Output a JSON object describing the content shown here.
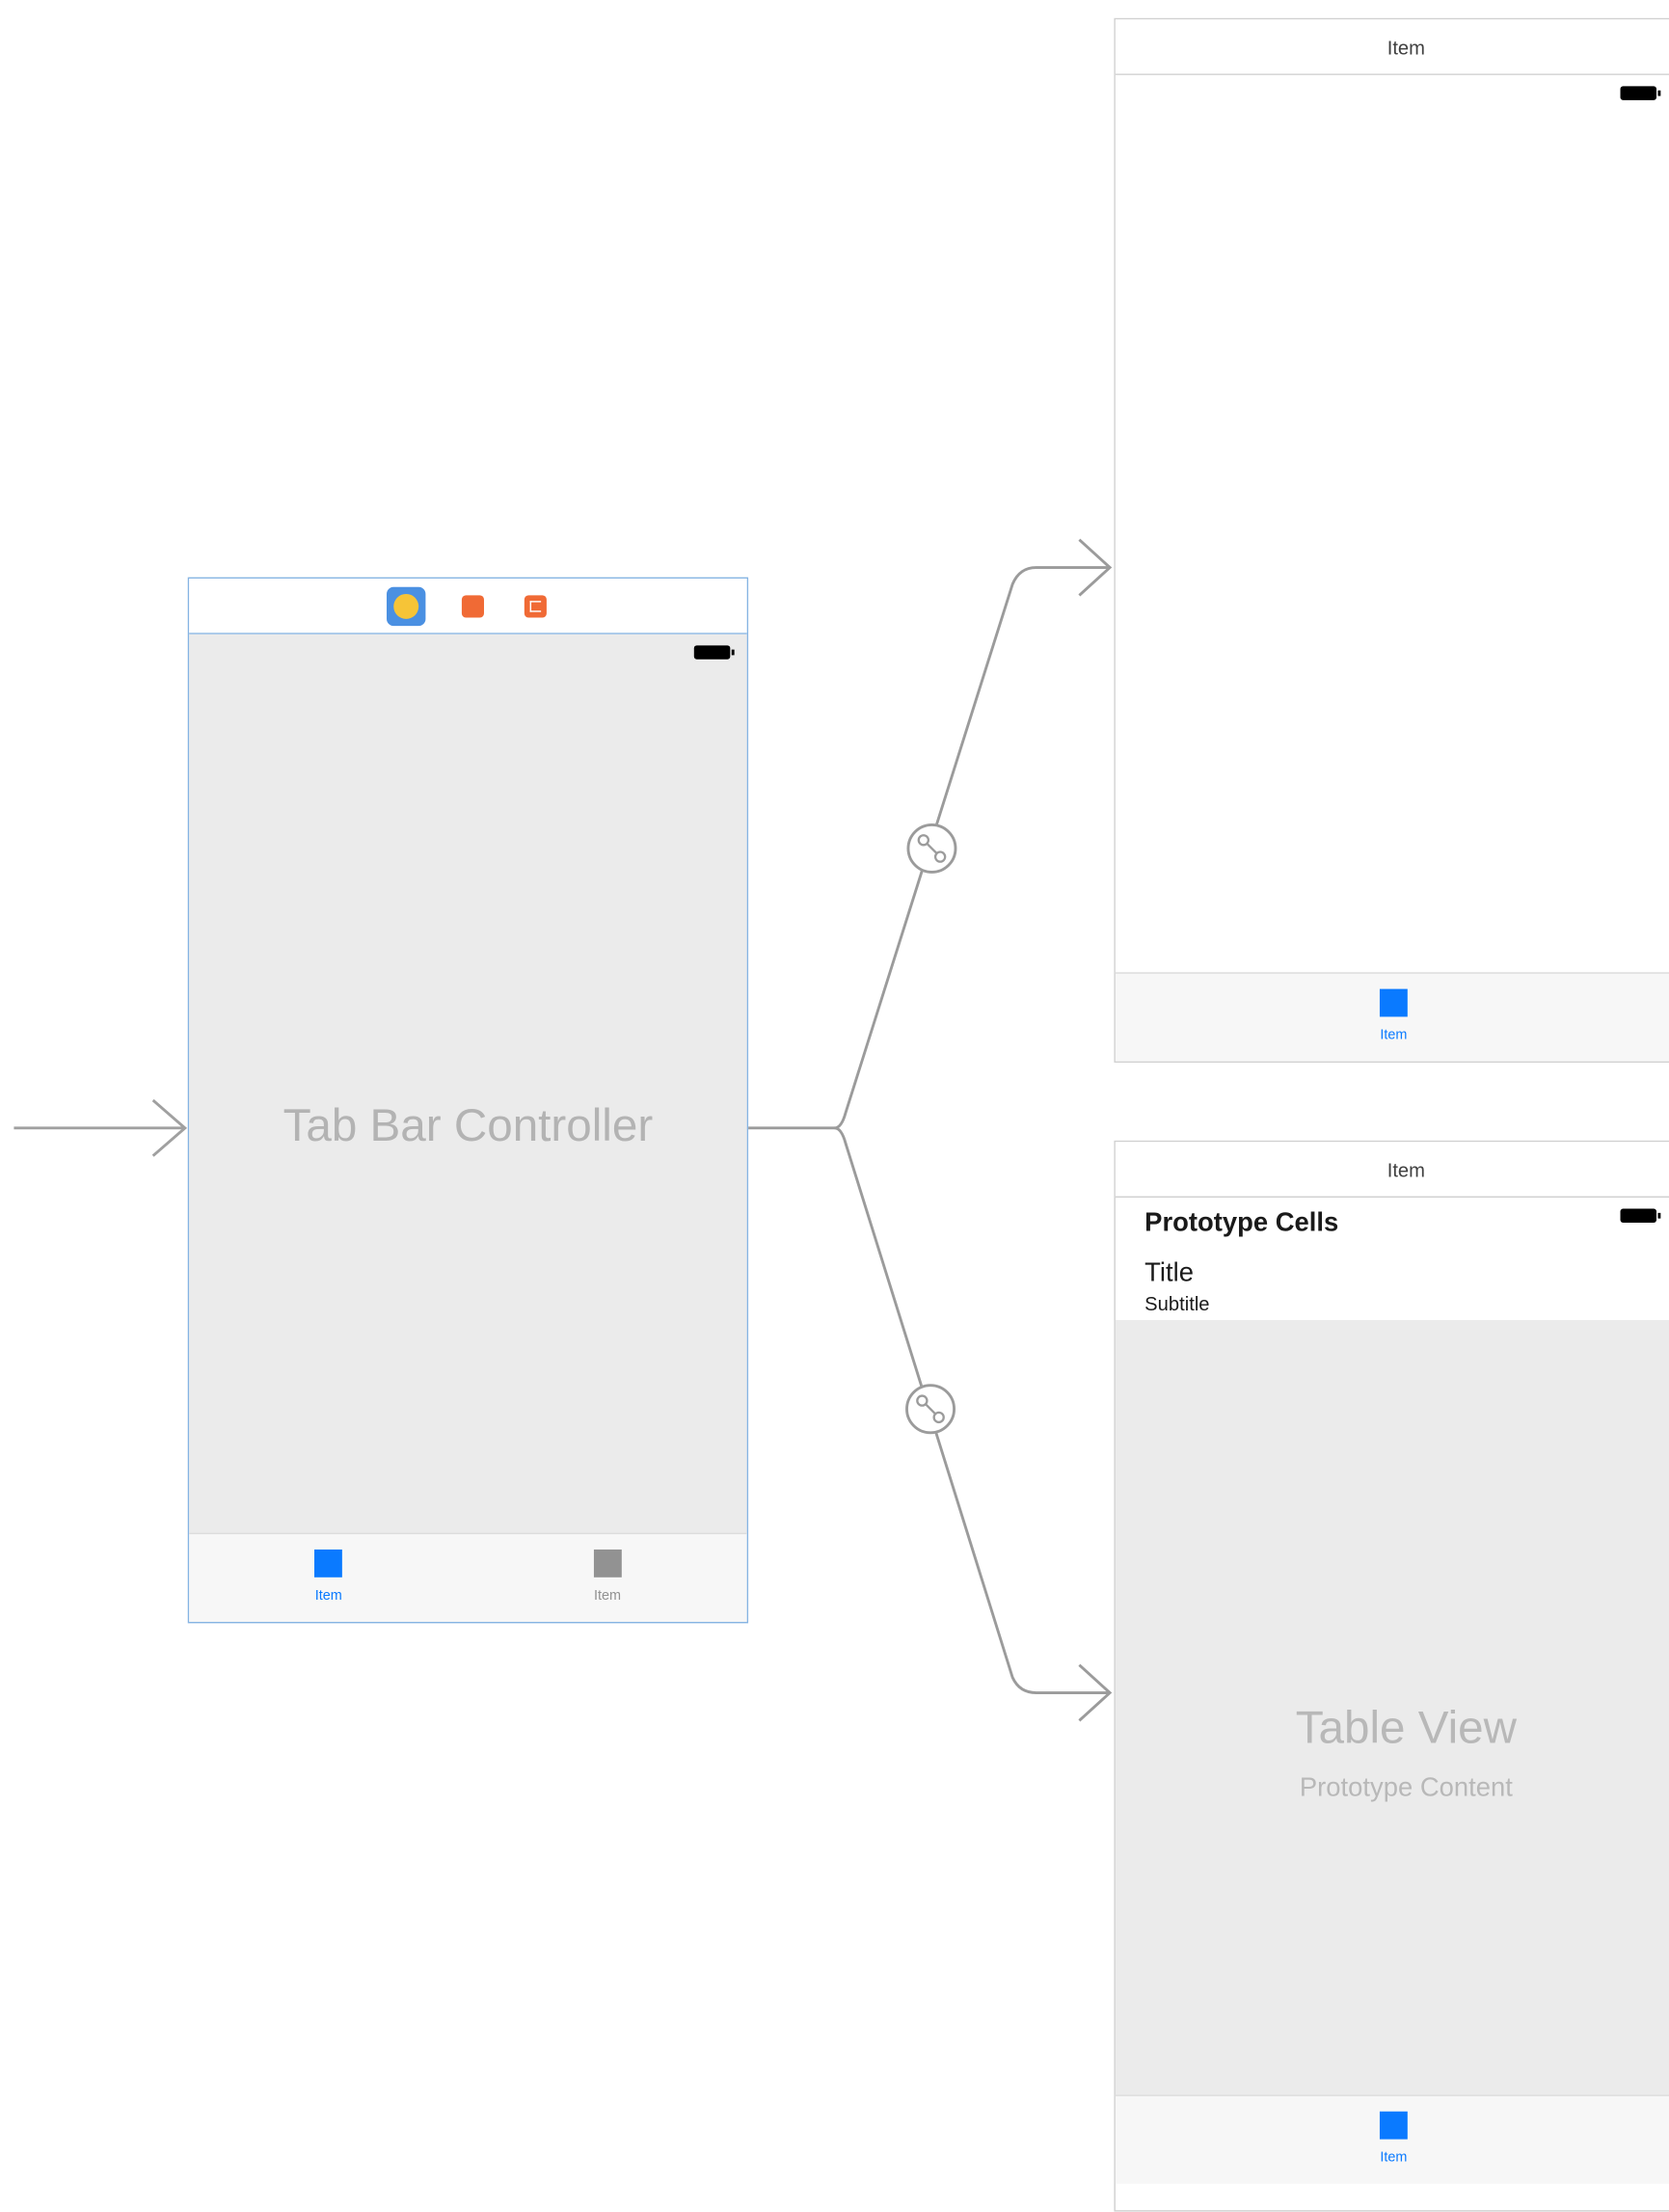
{
  "tab_bar_controller": {
    "title": "Tab Bar Controller",
    "dock_icons": [
      "view-controller-icon",
      "first-responder-icon",
      "exit-icon"
    ],
    "tabs": [
      {
        "label": "Item",
        "state": "active"
      },
      {
        "label": "Item",
        "state": "inactive"
      }
    ]
  },
  "view_controller": {
    "header_title": "Item",
    "tab_label": "Item"
  },
  "table_view_controller": {
    "header_title": "Item",
    "section_title": "Prototype Cells",
    "cell_title": "Title",
    "cell_subtitle": "Subtitle",
    "placeholder_title": "Table View",
    "placeholder_subtitle": "Prototype Content",
    "tab_label": "Item"
  },
  "colors": {
    "accent": "#0a7aff",
    "inactive": "#929292",
    "selection": "#86b4e3",
    "segue": "#9b9b9b"
  }
}
